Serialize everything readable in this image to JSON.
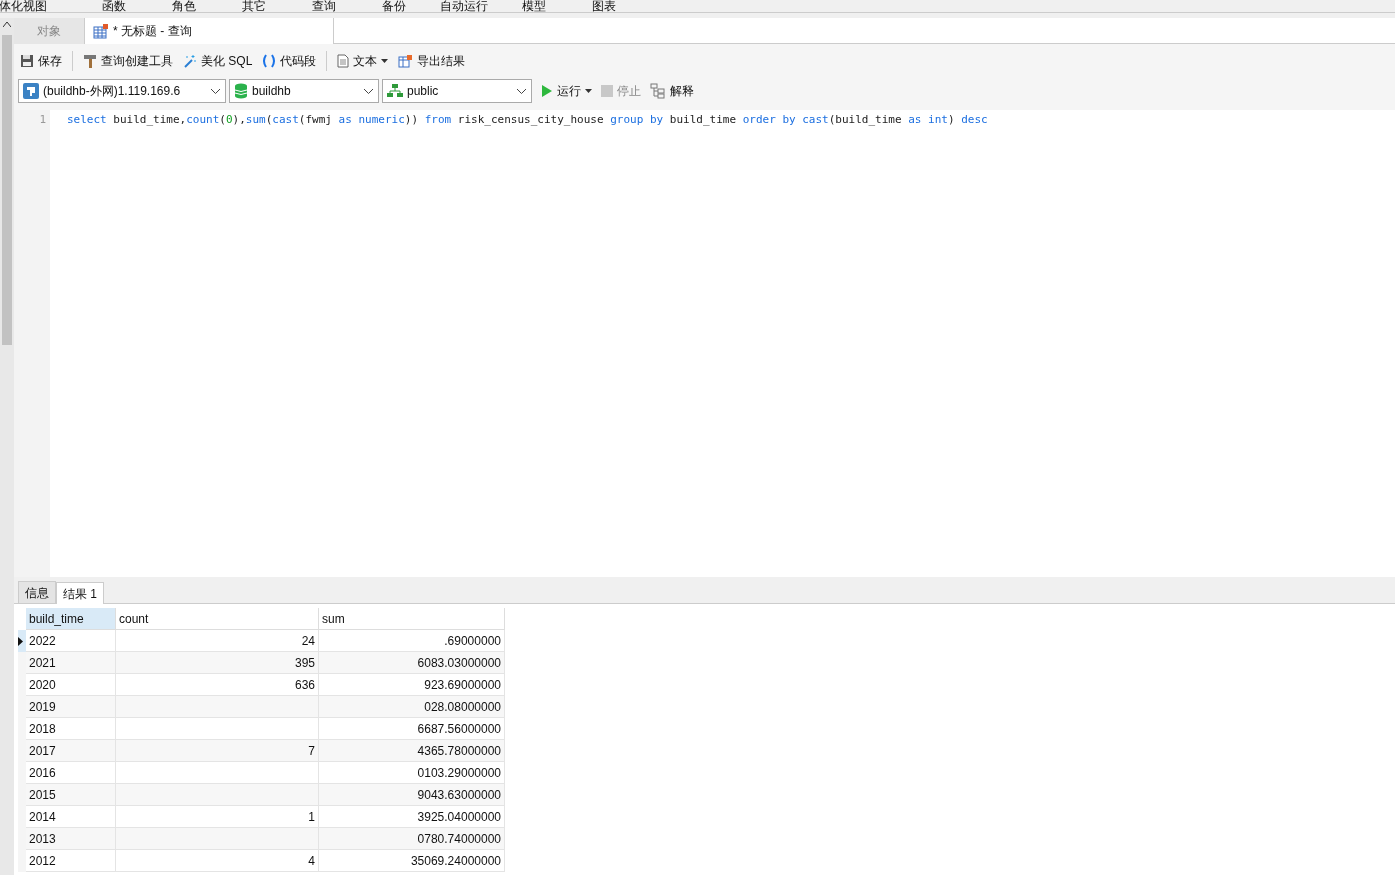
{
  "menu_bar": [
    "体化视图",
    "函数",
    "角色",
    "其它",
    "查询",
    "备份",
    "自动运行",
    "模型",
    "图表"
  ],
  "tabs": [
    {
      "label": "对象",
      "selected": false
    },
    {
      "label": "* 无标题 - 查询",
      "selected": true
    }
  ],
  "toolbar": [
    "保存",
    "查询创建工具",
    "美化 SQL",
    "代码段",
    "文本",
    "导出结果"
  ],
  "selectors": [
    "(buildhb-外网)1.119.169.6",
    "buildhb",
    "public"
  ],
  "run_controls": [
    {
      "label": "运行",
      "disabled": false
    },
    {
      "label": "停止",
      "disabled": true
    },
    {
      "label": "解释",
      "disabled": false
    }
  ],
  "editor": {
    "lines": [
      {
        "number": "1",
        "tokens": [
          {
            "kind": "keyword",
            "text": "select"
          },
          {
            "kind": "plain",
            "text": " build_time,"
          },
          {
            "kind": "keyword",
            "text": "count"
          },
          {
            "kind": "plain",
            "text": "("
          },
          {
            "kind": "number",
            "text": "0"
          },
          {
            "kind": "plain",
            "text": "),"
          },
          {
            "kind": "keyword",
            "text": "sum"
          },
          {
            "kind": "plain",
            "text": "("
          },
          {
            "kind": "keyword",
            "text": "cast"
          },
          {
            "kind": "plain",
            "text": "(fwmj "
          },
          {
            "kind": "keyword",
            "text": "as numeric"
          },
          {
            "kind": "plain",
            "text": ")) "
          },
          {
            "kind": "keyword",
            "text": "from"
          },
          {
            "kind": "plain",
            "text": " risk_census_city_house "
          },
          {
            "kind": "keyword",
            "text": "group by"
          },
          {
            "kind": "plain",
            "text": " build_time "
          },
          {
            "kind": "keyword",
            "text": "order by cast"
          },
          {
            "kind": "plain",
            "text": "(build_time "
          },
          {
            "kind": "keyword",
            "text": "as int"
          },
          {
            "kind": "plain",
            "text": ") "
          },
          {
            "kind": "keyword",
            "text": "desc"
          }
        ]
      }
    ]
  },
  "result_tabs": [
    {
      "label": "信息",
      "selected": false
    },
    {
      "label": "结果 1",
      "selected": true
    }
  ],
  "table": {
    "columns": [
      "build_time",
      "count",
      "sum"
    ],
    "rows": [
      {
        "cells": [
          "2022",
          "24",
          ".69000000"
        ],
        "current": true
      },
      {
        "cells": [
          "2021",
          "395",
          "6083.03000000"
        ],
        "current": false
      },
      {
        "cells": [
          "2020",
          "636",
          "923.69000000"
        ],
        "current": false
      },
      {
        "cells": [
          "2019",
          "",
          "028.08000000"
        ],
        "current": false
      },
      {
        "cells": [
          "2018",
          "",
          "6687.56000000"
        ],
        "current": false
      },
      {
        "cells": [
          "2017",
          "7",
          "4365.78000000"
        ],
        "current": false
      },
      {
        "cells": [
          "2016",
          "",
          "0103.29000000"
        ],
        "current": false
      },
      {
        "cells": [
          "2015",
          "",
          "9043.63000000"
        ],
        "current": false
      },
      {
        "cells": [
          "2014",
          "1",
          "3925.04000000"
        ],
        "current": false
      },
      {
        "cells": [
          "2013",
          "",
          "0780.74000000"
        ],
        "current": false
      },
      {
        "cells": [
          "2012",
          "4",
          "35069.24000000"
        ],
        "current": false
      }
    ]
  }
}
